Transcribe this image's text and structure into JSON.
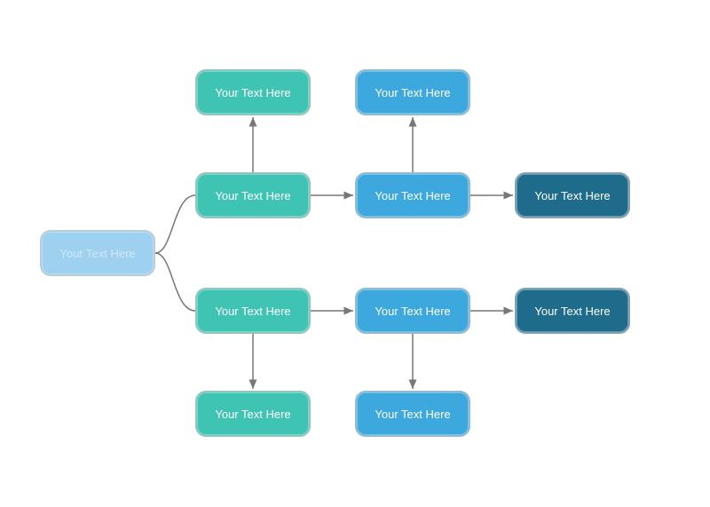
{
  "nodes": {
    "root": {
      "label": "Your Text Here",
      "color": "light-blue"
    },
    "r1c1_top": {
      "label": "Your Text Here",
      "color": "teal"
    },
    "r1c2_top": {
      "label": "Your Text Here",
      "color": "sky"
    },
    "r2c1_mid": {
      "label": "Your Text Here",
      "color": "teal"
    },
    "r2c2_mid": {
      "label": "Your Text Here",
      "color": "sky"
    },
    "r2c3_mid": {
      "label": "Your Text Here",
      "color": "dark-blue"
    },
    "r3c1_mid": {
      "label": "Your Text Here",
      "color": "teal"
    },
    "r3c2_mid": {
      "label": "Your Text Here",
      "color": "sky"
    },
    "r3c3_mid": {
      "label": "Your Text Here",
      "color": "dark-blue"
    },
    "r4c1_bot": {
      "label": "Your Text Here",
      "color": "teal"
    },
    "r4c2_bot": {
      "label": "Your Text Here",
      "color": "sky"
    }
  },
  "colors": {
    "light-blue": "#9ED1F0",
    "teal": "#3FC4B4",
    "sky": "#3DA8DE",
    "dark-blue": "#1E6B8C",
    "connector": "#777777"
  }
}
